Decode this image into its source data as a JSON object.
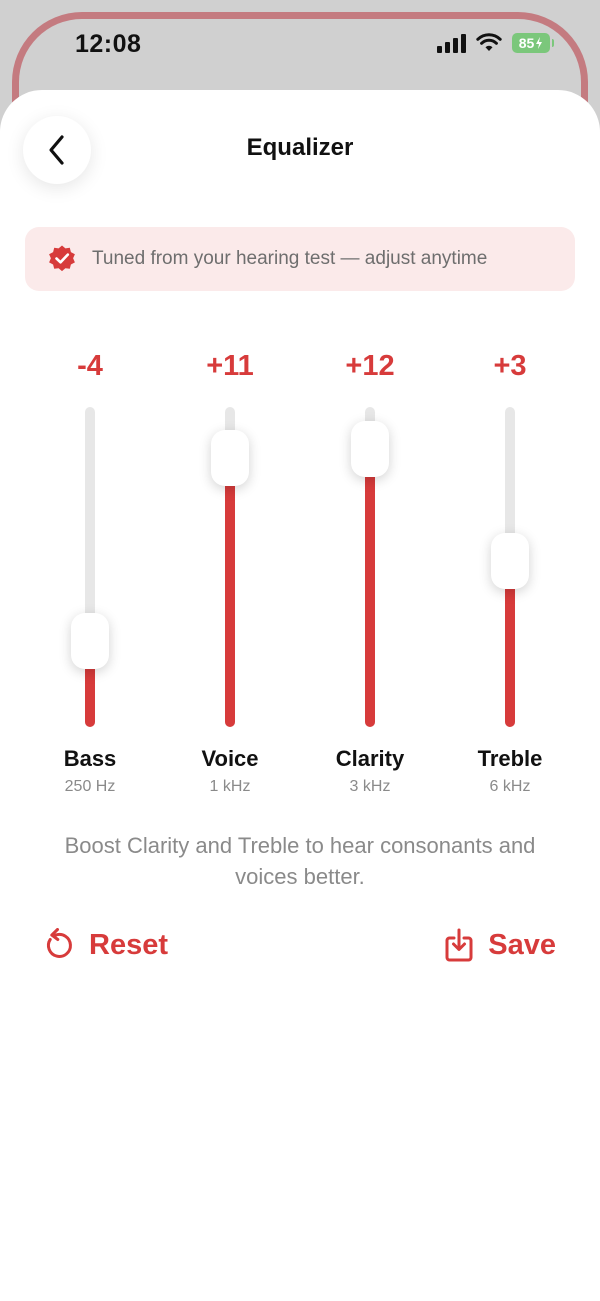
{
  "status_bar": {
    "time": "12:08",
    "battery": "85"
  },
  "header": {
    "title": "Equalizer"
  },
  "banner": {
    "text": "Tuned from your hearing test — adjust anytime"
  },
  "bands": [
    {
      "value_label": "-4",
      "name": "Bass",
      "frequency": "250 Hz",
      "level": 0.27
    },
    {
      "value_label": "+11",
      "name": "Voice",
      "frequency": "1 kHz",
      "level": 0.84
    },
    {
      "value_label": "+12",
      "name": "Clarity",
      "frequency": "3 kHz",
      "level": 0.87
    },
    {
      "value_label": "+3",
      "name": "Treble",
      "frequency": "6 kHz",
      "level": 0.52
    }
  ],
  "hint": {
    "text": "Boost Clarity and Treble to hear consonants and voices better."
  },
  "actions": {
    "reset_label": "Reset",
    "save_label": "Save"
  },
  "colors": {
    "accent": "#d73b3b",
    "banner_background": "#fbeaea",
    "track": "#e7e7e7",
    "battery": "#7bc77b"
  },
  "icons": {
    "back": "chevron-left-icon",
    "banner": "verified-badge-icon",
    "reset": "reset-icon",
    "save": "save-download-icon"
  }
}
